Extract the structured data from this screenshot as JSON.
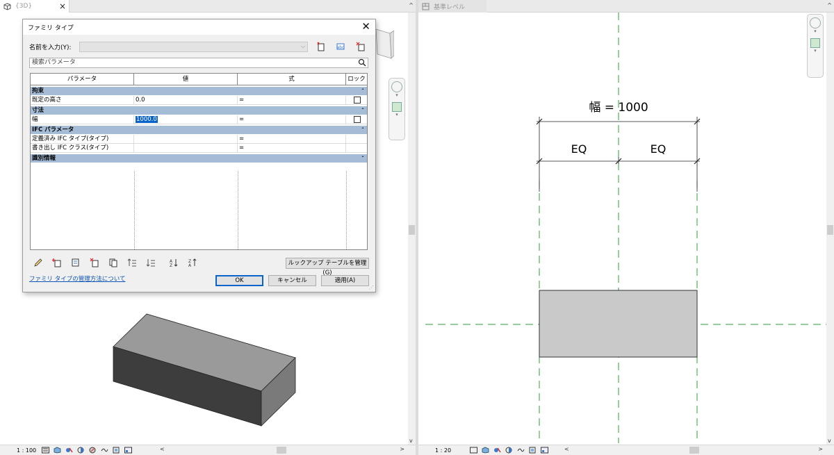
{
  "left_view": {
    "tab_title": "{3D}",
    "tab_close": "×",
    "scale": "1 : 100",
    "scroll_left": "<",
    "scroll_right": ">",
    "scroll_up": "^",
    "scroll_down": "v"
  },
  "right_view": {
    "tab_title": "基準レベル",
    "scale": "1 : 20",
    "scroll_left": "<",
    "scroll_right": ">",
    "scroll_up": "^",
    "scroll_down": "v",
    "dimension_total": "幅 = 1000",
    "dimension_eq_left": "EQ",
    "dimension_eq_right": "EQ"
  },
  "dialog": {
    "title": "ファミリ タイプ",
    "close_label": "✕",
    "name_label": "名前を入力(Y):",
    "name_value": "",
    "search_placeholder": "検索パラメータ",
    "columns": [
      "パラメータ",
      "値",
      "式",
      "ロック"
    ],
    "groups": [
      {
        "name": "拘束",
        "chevron": "ˆ",
        "rows": [
          {
            "param": "既定の高さ",
            "value": "0.0",
            "formula": "=",
            "lock": true
          }
        ]
      },
      {
        "name": "寸法",
        "chevron": "ˆ",
        "rows": [
          {
            "param": "幅",
            "value": "1000.0",
            "formula": "=",
            "lock": true
          }
        ]
      },
      {
        "name": "IFC パラメータ",
        "chevron": "ˆ",
        "rows": [
          {
            "param": "定義済み IFC タイプ(タイプ)",
            "value": "",
            "formula": "=",
            "lock": false
          },
          {
            "param": "書き出し IFC クラス(タイプ)",
            "value": "",
            "formula": "=",
            "lock": false
          }
        ]
      },
      {
        "name": "識別情報",
        "chevron": "ˇ",
        "rows": []
      }
    ],
    "lookup_button": "ルックアップ テーブルを管理(G)",
    "help_link": "ファミリ タイプの管理方法について",
    "ok_button": "OK",
    "cancel_button": "キャンセル",
    "apply_button": "適用(A)"
  },
  "colors": {
    "group_header": "#a5bcd6",
    "selection": "#0a63c9",
    "reference_plane": "#2e9e3a",
    "box_fill_plan": "#c9c9c9"
  }
}
